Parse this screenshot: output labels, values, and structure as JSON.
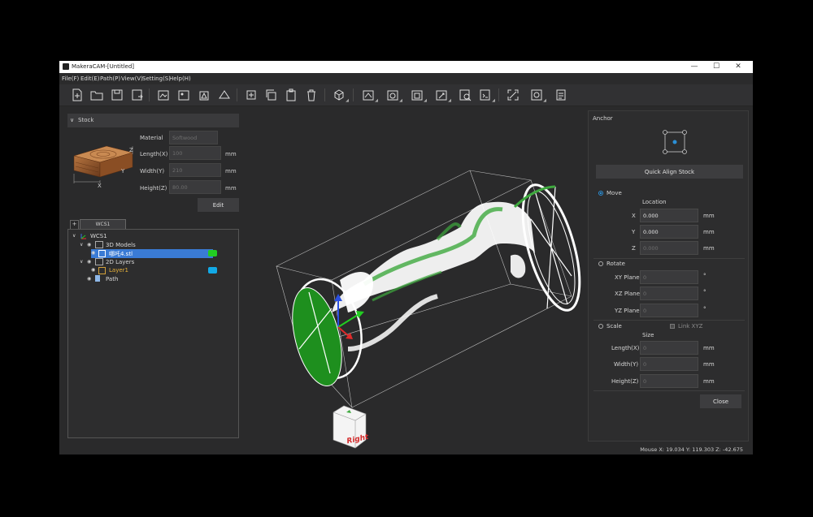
{
  "window": {
    "title": "MakeraCAM-[Untitled]",
    "minimize": "—",
    "maximize": "☐",
    "close": "✕"
  },
  "menu": [
    "File(F)",
    "Edit(E)",
    "Path(P)",
    "View(V)",
    "Setting(S)",
    "Help(H)"
  ],
  "toolbar": {
    "icons": [
      "new-file-icon",
      "open-folder-icon",
      "save-icon",
      "save-as-icon",
      "import-2d-icon",
      "import-image-icon",
      "import-3d-icon",
      "import-stl-icon",
      "add-icon",
      "copy-icon",
      "paste-icon",
      "delete-icon",
      "transform-icon",
      "path-2d-icon",
      "path-3d-icon",
      "path-4axis-icon",
      "path-drill-icon",
      "simulate-icon",
      "gcode-icon",
      "fit-view-icon",
      "settings-icon",
      "report-icon"
    ]
  },
  "stock": {
    "header": "Stock",
    "material_label": "Material",
    "material_value": "Softwood",
    "length_label": "Length(X)",
    "length_value": "100",
    "width_label": "Width(Y)",
    "width_value": "210",
    "height_label": "Height(Z)",
    "height_value": "80.00",
    "unit": "mm",
    "edit_button": "Edit",
    "axis_x": "X",
    "axis_y": "Y",
    "axis_z": "Z"
  },
  "tree": {
    "add_tab": "+",
    "tab": "WCS1",
    "root": "WCS1",
    "models": "3D Models",
    "model_file": "哪吒4.stl",
    "layers": "2D Layers",
    "layer1": "Layer1",
    "path": "Path",
    "colors": {
      "model": "#22cc22",
      "layer": "#12a9e6",
      "selected": "#3a7bd5"
    }
  },
  "viewport": {
    "cube_label": "Right",
    "colors": {
      "mesh": "#ffffff",
      "mesh_accent": "#3ea93e",
      "face": "#1e8f1e"
    }
  },
  "anchor": {
    "title": "Anchor",
    "quick_align": "Quick Align Stock",
    "move_label": "Move",
    "location_label": "Location",
    "x_label": "X",
    "x_value": "0.000",
    "y_label": "Y",
    "y_value": "0.000",
    "z_label": "Z",
    "z_value": "0.000",
    "rotate_label": "Rotate",
    "xy_label": "XY Plane",
    "xy_value": "0",
    "xz_label": "XZ Plane",
    "xz_value": "0",
    "yz_label": "YZ Plane",
    "yz_value": "0",
    "deg": "°",
    "scale_label": "Scale",
    "link_label": "Link XYZ",
    "size_label": "Size",
    "slen_label": "Length(X)",
    "slen_value": "0",
    "swid_label": "Width(Y)",
    "swid_value": "0",
    "shei_label": "Height(Z)",
    "shei_value": "0",
    "unit": "mm",
    "close_button": "Close"
  },
  "status": {
    "mouse": "Mouse X: 19.034 Y: 119.303 Z: -42.675"
  }
}
